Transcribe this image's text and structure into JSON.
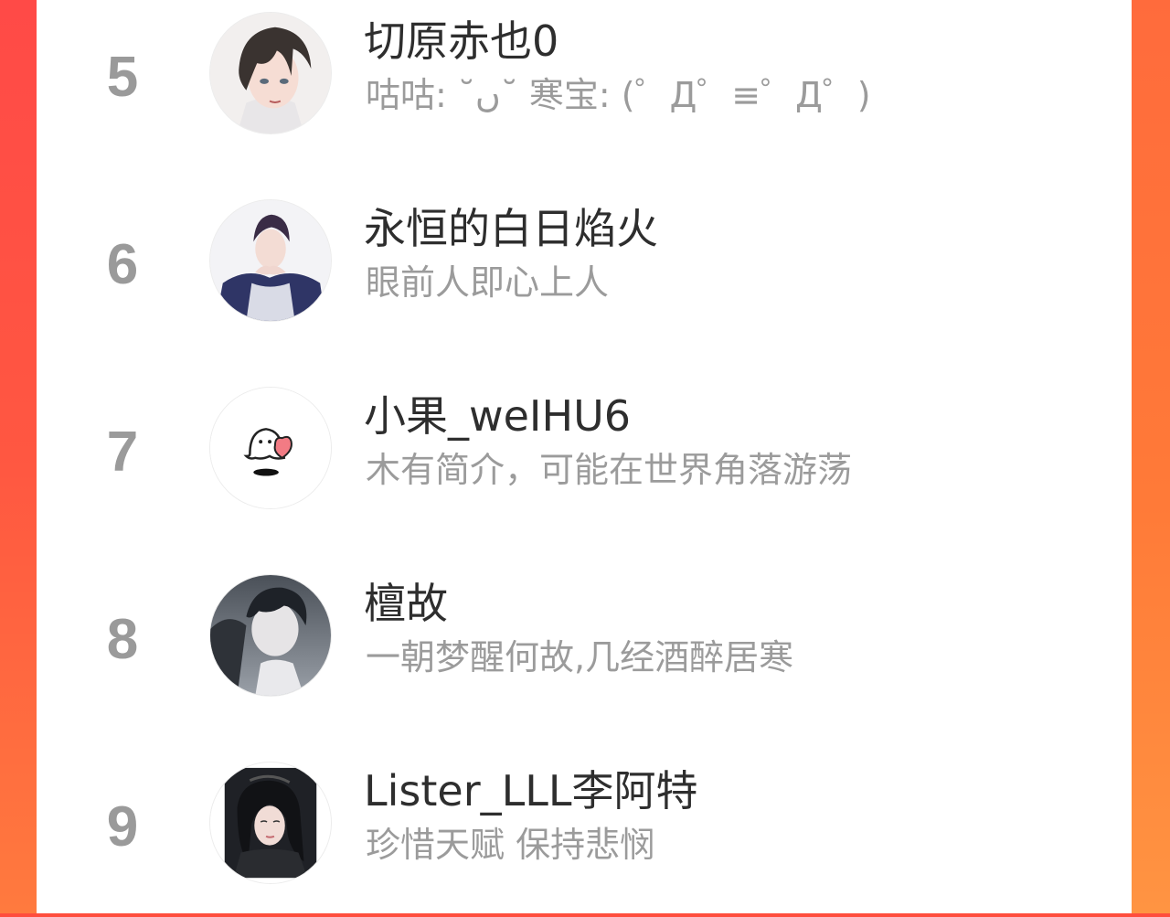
{
  "ranking": [
    {
      "rank": "5",
      "name": "切原赤也0",
      "bio": "咕咕: ˘ں˘ 寒宝: (゜Д゜≡゜Д゜)",
      "avatar": "anime-boy-dark-hair-avatar"
    },
    {
      "rank": "6",
      "name": "永恒的白日焰火",
      "bio": "眼前人即心上人",
      "avatar": "anime-man-suit-avatar"
    },
    {
      "rank": "7",
      "name": "小果_weIHU6",
      "bio": "木有简介，可能在世界角落游荡",
      "avatar": "ghost-with-heart-avatar"
    },
    {
      "rank": "8",
      "name": "檀故",
      "bio": "一朝梦醒何故,几经酒醉居寒",
      "avatar": "anime-man-grey-tone-avatar"
    },
    {
      "rank": "9",
      "name": "Lister_LLL李阿特",
      "bio": "珍惜天赋 保持悲悯",
      "avatar": "girl-photo-avatar"
    }
  ],
  "colors": {
    "background_gradient_top": "#ff4d3d",
    "background_gradient_bottom": "#ff9a45",
    "panel": "#ffffff",
    "rank_text": "#9a9a9a",
    "name_text": "#2e2e2e",
    "bio_text": "#9b9b9b"
  }
}
